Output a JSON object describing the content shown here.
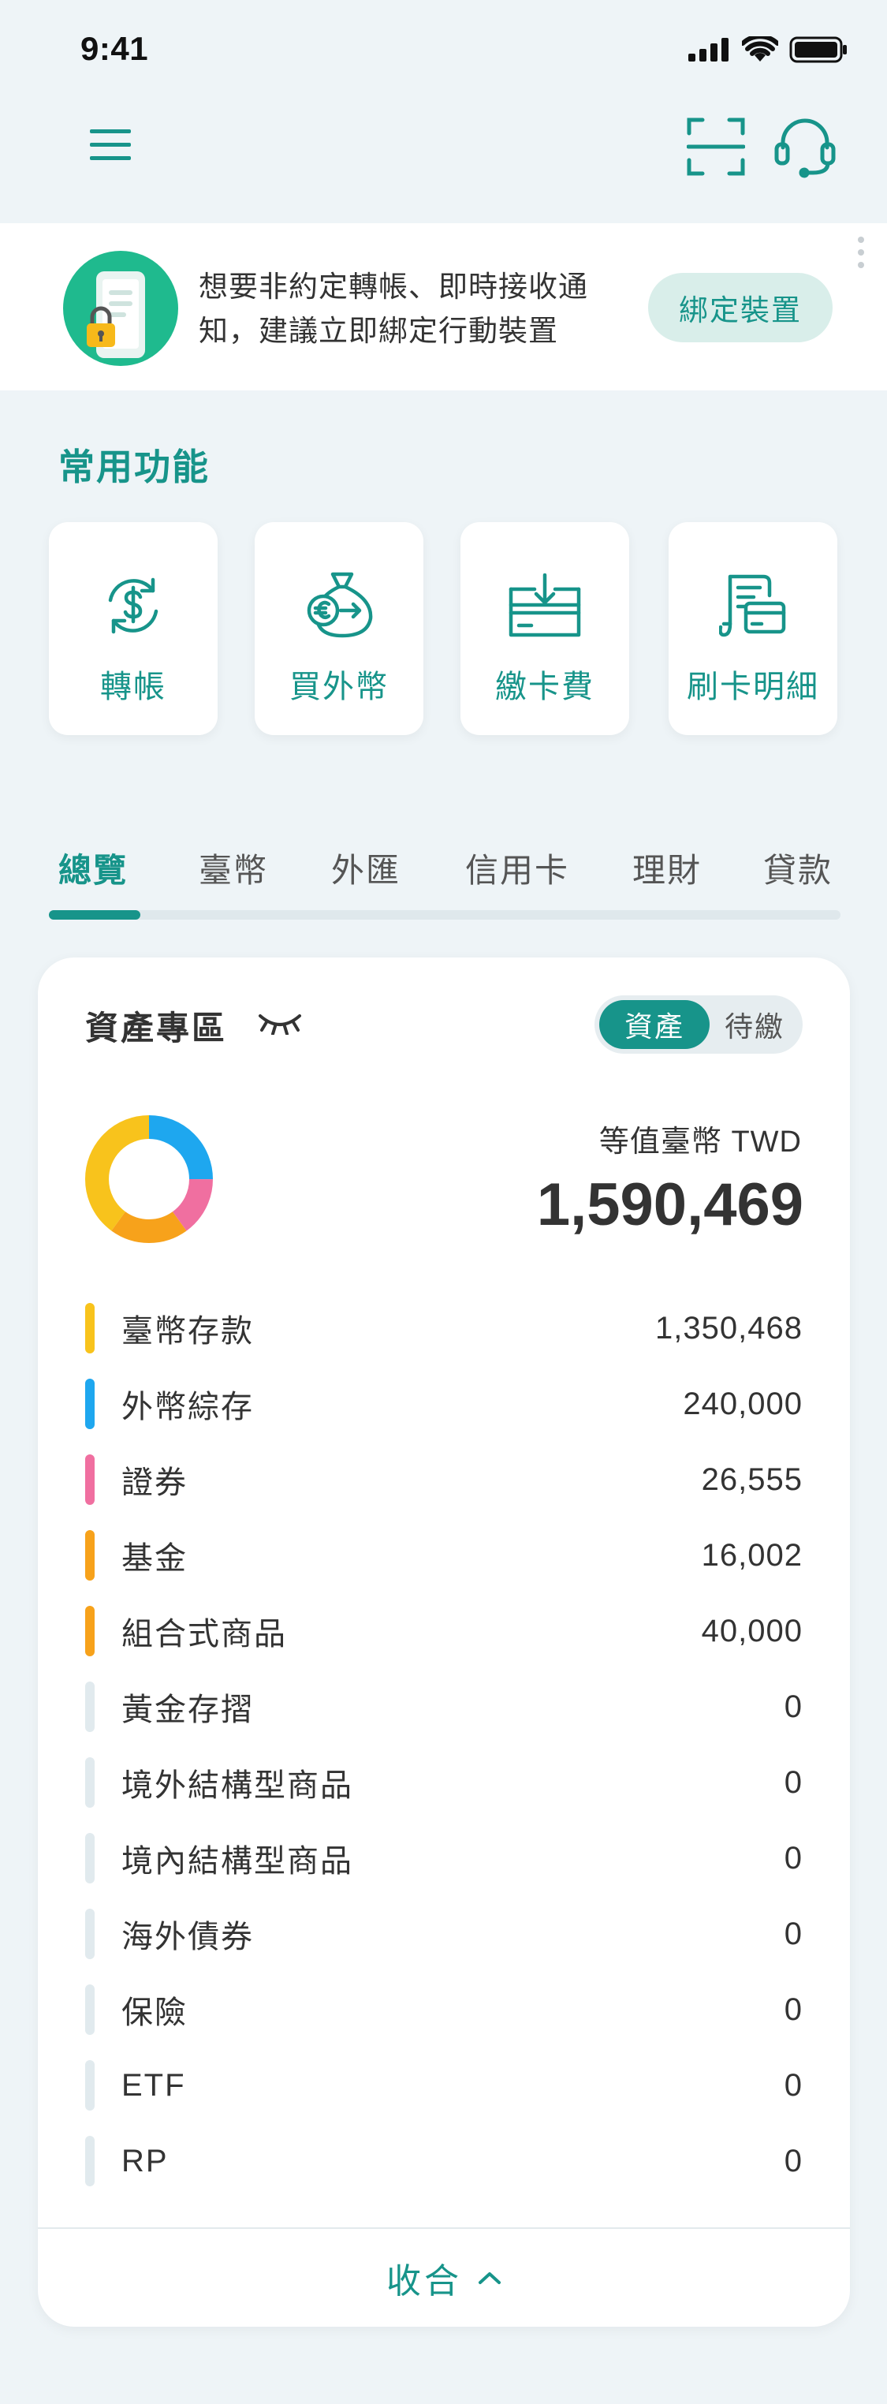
{
  "status_bar": {
    "time": "9:41"
  },
  "nav": {
    "menu_icon": "hamburger-menu-icon",
    "scan_icon": "scan-frame-icon",
    "support_icon": "headset-icon"
  },
  "bind_banner": {
    "message": "想要非約定轉帳、即時接收通知，建議立即綁定行動裝置",
    "button_label": "綁定裝置"
  },
  "quick_functions": {
    "title": "常用功能",
    "items": [
      {
        "label": "轉帳",
        "icon": "transfer-dollar-icon"
      },
      {
        "label": "買外幣",
        "icon": "foreign-currency-bag-icon"
      },
      {
        "label": "繳卡費",
        "icon": "pay-card-bill-icon"
      },
      {
        "label": "刷卡明細",
        "icon": "card-statement-icon"
      }
    ]
  },
  "tabs": [
    {
      "label": "總覽",
      "active": true
    },
    {
      "label": "臺幣",
      "active": false
    },
    {
      "label": "外匯",
      "active": false
    },
    {
      "label": "信用卡",
      "active": false
    },
    {
      "label": "理財",
      "active": false
    },
    {
      "label": "貸款",
      "active": false
    }
  ],
  "asset_zone": {
    "title": "資產專區",
    "toggle": {
      "active": "資產",
      "inactive": "待繳"
    },
    "total_label": "等值臺幣 TWD",
    "total_value": "1,590,469",
    "items": [
      {
        "name": "臺幣存款",
        "value": "1,350,468",
        "color": "#f8c31c"
      },
      {
        "name": "外幣綜存",
        "value": "240,000",
        "color": "#1ea7ef"
      },
      {
        "name": "證券",
        "value": "26,555",
        "color": "#f06fa0"
      },
      {
        "name": "基金",
        "value": "16,002",
        "color": "#f7a21b"
      },
      {
        "name": "組合式商品",
        "value": "40,000",
        "color": "#f7a21b"
      },
      {
        "name": "黃金存摺",
        "value": "0",
        "color": "#e1eaee"
      },
      {
        "name": "境外結構型商品",
        "value": "0",
        "color": "#e1eaee"
      },
      {
        "name": "境內結構型商品",
        "value": "0",
        "color": "#e1eaee"
      },
      {
        "name": "海外債券",
        "value": "0",
        "color": "#e1eaee"
      },
      {
        "name": "保險",
        "value": "0",
        "color": "#e1eaee"
      },
      {
        "name": "ETF",
        "value": "0",
        "color": "#e1eaee"
      },
      {
        "name": "RP",
        "value": "0",
        "color": "#e1eaee"
      }
    ],
    "collapse_label": "收合"
  },
  "colors": {
    "accent": "#17948a",
    "background": "#eef4f7",
    "banner_green": "#1fba8e"
  }
}
